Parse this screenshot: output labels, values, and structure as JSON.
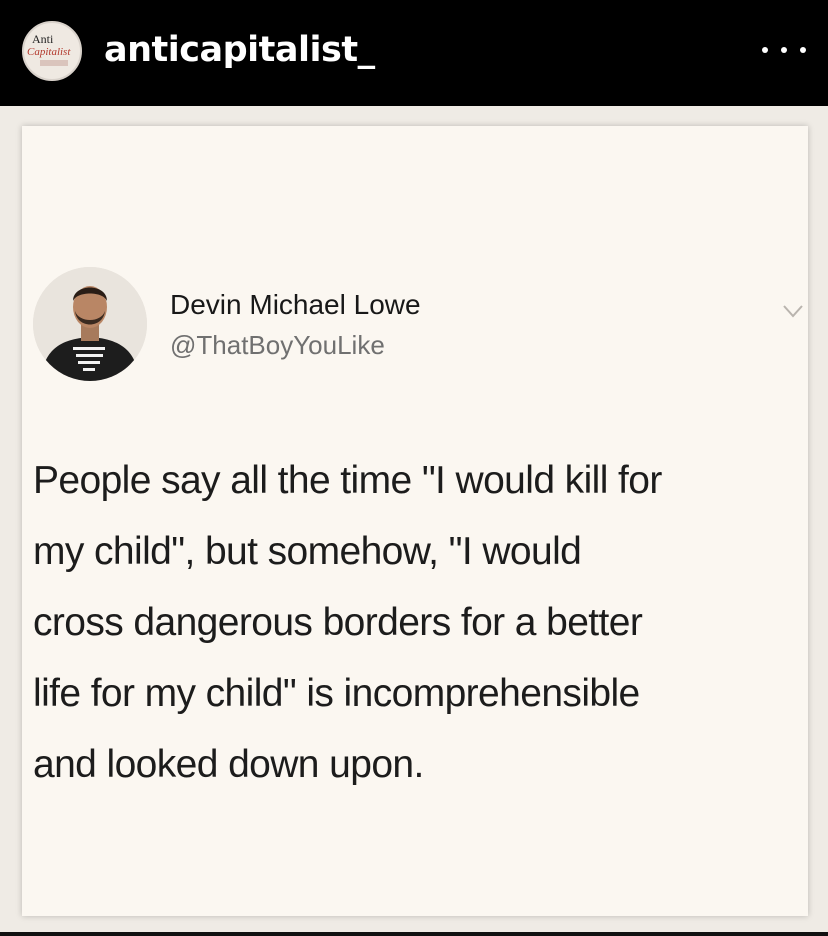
{
  "header": {
    "username": "anticapitalist_",
    "avatar_logo": {
      "line1": "Anti",
      "line2": "Capitalist"
    },
    "more_icon": "more-horizontal-icon"
  },
  "tweet": {
    "author_name": "Devin Michael Lowe",
    "handle": "@ThatBoyYouLike",
    "avatar_shirt_text": "BLACK TRANS LOVE IS",
    "chevron_icon": "chevron-down-icon",
    "text_lines": [
      "People say all the time \"I would kill for",
      "my child\", but somehow, \"I would",
      "cross dangerous borders for a better",
      "life for my child\" is incomprehensible",
      "and looked down upon."
    ]
  },
  "colors": {
    "header_bg": "#000000",
    "card_bg": "#fbf7f1",
    "text": "#1c1c1c",
    "handle": "#707070"
  }
}
